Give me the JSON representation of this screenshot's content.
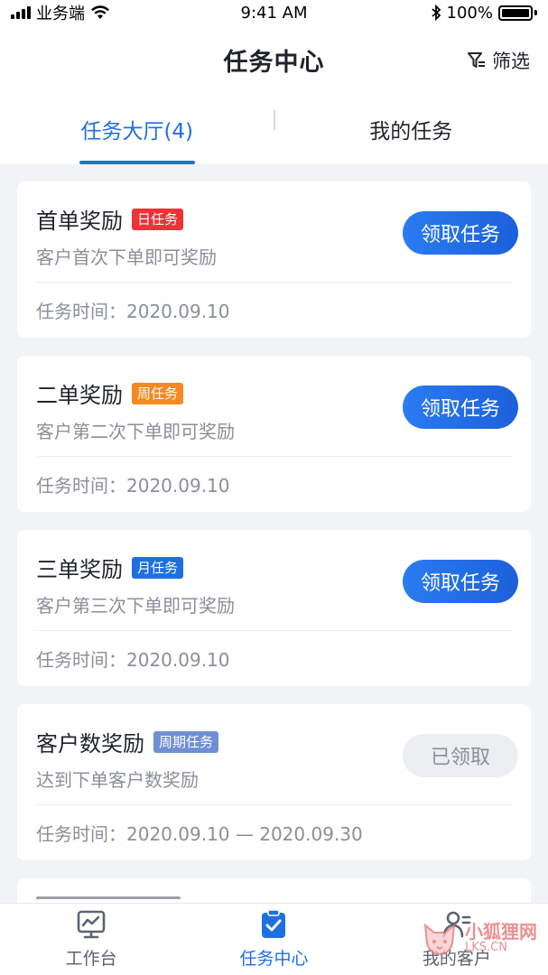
{
  "status_bar": {
    "carrier": "业务端",
    "time": "9:41 AM",
    "battery": "100%"
  },
  "header": {
    "title": "任务中心",
    "filter_label": "筛选"
  },
  "tabs": [
    {
      "label": "任务大厅(4)",
      "active": true
    },
    {
      "label": "我的任务",
      "active": false
    }
  ],
  "tasks": [
    {
      "title": "首单奖励",
      "tag": "日任务",
      "tag_color": "#ef3138",
      "desc": "客户首次下单即可奖励",
      "time": "任务时间：2020.09.10",
      "action": "领取任务",
      "claimed": false
    },
    {
      "title": "二单奖励",
      "tag": "周任务",
      "tag_color": "#f6891f",
      "desc": "客户第二次下单即可奖励",
      "time": "任务时间：2020.09.10",
      "action": "领取任务",
      "claimed": false
    },
    {
      "title": "三单奖励",
      "tag": "月任务",
      "tag_color": "#1f6fe0",
      "desc": "客户第三次下单即可奖励",
      "time": "任务时间：2020.09.10",
      "action": "领取任务",
      "claimed": false
    },
    {
      "title": "客户数奖励",
      "tag": "周期任务",
      "tag_color": "#6f8fd6",
      "desc": "达到下单客户数奖励",
      "time": "任务时间：2020.09.10 — 2020.09.30",
      "action": "已领取",
      "claimed": true
    }
  ],
  "bottom_nav": [
    {
      "label": "工作台",
      "icon": "chart-board-icon",
      "active": false
    },
    {
      "label": "任务中心",
      "icon": "task-check-icon",
      "active": true
    },
    {
      "label": "我的客户",
      "icon": "customer-icon",
      "active": false
    }
  ],
  "watermark": {
    "text_cn": "小狐狸网",
    "text_en": "LKS.CN"
  },
  "colors": {
    "accent": "#1f6fe0",
    "background": "#f2f3f5"
  }
}
